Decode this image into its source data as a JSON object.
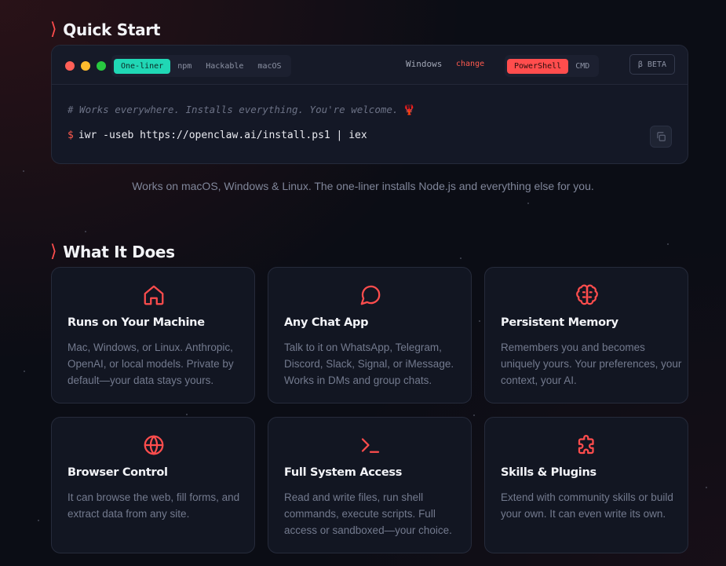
{
  "quick_start": {
    "title": "Quick Start",
    "tabs": [
      "One-liner",
      "npm",
      "Hackable",
      "macOS"
    ],
    "active_tab": "One-liner",
    "os_label": "Windows",
    "os_change": "change",
    "shells": [
      "PowerShell",
      "CMD"
    ],
    "active_shell": "PowerShell",
    "beta_label": "β BETA",
    "comment": "# Works everywhere. Installs everything. You're welcome.",
    "comment_emoji": "🦞",
    "prompt": "$",
    "command": "iwr -useb https://openclaw.ai/install.ps1 | iex",
    "copy_icon": "copy-icon",
    "note": "Works on macOS, Windows & Linux. The one-liner installs Node.js and everything else for you."
  },
  "what_it_does": {
    "title": "What It Does",
    "cards": [
      {
        "icon": "home-icon",
        "title": "Runs on Your Machine",
        "desc": "Mac, Windows, or Linux. Anthropic, OpenAI, or local models. Private by default—your data stays yours."
      },
      {
        "icon": "chat-bubble-icon",
        "title": "Any Chat App",
        "desc": "Talk to it on WhatsApp, Telegram, Discord, Slack, Signal, or iMessage. Works in DMs and group chats."
      },
      {
        "icon": "brain-icon",
        "title": "Persistent Memory",
        "desc": "Remembers you and becomes uniquely yours. Your preferences, your context, your AI."
      },
      {
        "icon": "globe-icon",
        "title": "Browser Control",
        "desc": "It can browse the web, fill forms, and extract data from any site."
      },
      {
        "icon": "terminal-icon",
        "title": "Full System Access",
        "desc": "Read and write files, run shell commands, execute scripts. Full access or sandboxed—your choice."
      },
      {
        "icon": "puzzle-icon",
        "title": "Skills & Plugins",
        "desc": "Extend with community skills or build your own. It can even write its own."
      }
    ]
  },
  "colors": {
    "accent_red": "#ff4d4d",
    "accent_teal": "#20d7b5",
    "background": "#0b0d15",
    "card_background": "#121622"
  }
}
